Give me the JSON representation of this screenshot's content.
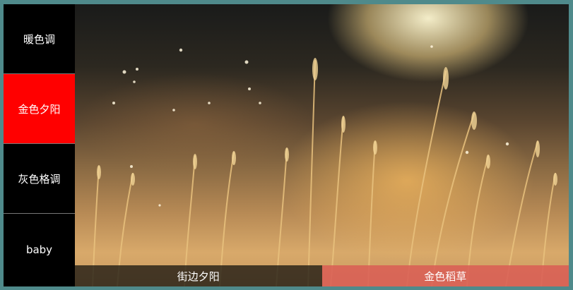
{
  "sidebar": {
    "items": [
      {
        "label": "暖色调"
      },
      {
        "label": "金色夕阳",
        "active": true
      },
      {
        "label": "灰色格调"
      },
      {
        "label": "baby"
      }
    ]
  },
  "stage": {
    "image_alt_subject": "golden grass at sunset",
    "captions": [
      {
        "label": "街边夕阳"
      },
      {
        "label": "金色稻草",
        "active": true
      }
    ]
  },
  "colors": {
    "page_border": "#4f8a8b",
    "sidebar_bg": "#000000",
    "sidebar_active": "#ff0000",
    "caption_active": "#da5f55"
  }
}
